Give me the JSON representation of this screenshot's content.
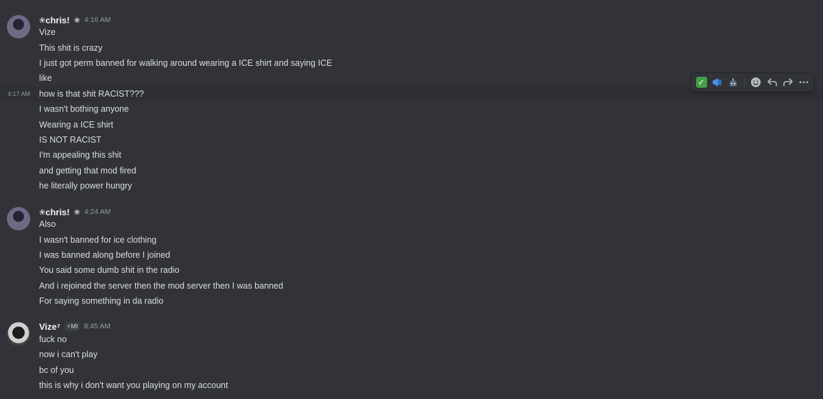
{
  "messages": [
    {
      "username": "chris!",
      "deco_left": "❀",
      "deco_right": "❀",
      "time": "4:16 AM",
      "lines": [
        "Vize",
        "This shit is crazy",
        "I just got perm banned for walking around wearing a ICE shirt and saying ICE",
        "like",
        "how is that shit RACIST???",
        "I wasn't bothing anyone",
        "Wearing a ICE shirt",
        "IS NOT RACIST",
        "I'm appealing this shit",
        "and getting that mod fired",
        "he literally power hungry"
      ],
      "hover_time": "4:17 AM"
    },
    {
      "username": "chris!",
      "deco_left": "❀",
      "deco_right": "❀",
      "time": "4:24 AM",
      "lines": [
        "Also",
        "I wasn't banned for ice clothing",
        "I was banned along before I joined",
        "You said some dumb shit in the radio",
        "And i rejoined the server then the mod server then I was banned",
        "For saying something in da radio"
      ]
    },
    {
      "username": "Vize⁷",
      "tag": "⚡MI",
      "time": "8:45 AM",
      "lines": [
        "fuck no",
        "now i can't play",
        "bc of you",
        "this is why i don't want you playing on my account"
      ]
    }
  ],
  "toolbar": {
    "icons": [
      "check-emoji",
      "megaphone-emoji",
      "robot-emoji",
      "add-reaction-icon",
      "reply-icon",
      "forward-icon",
      "more-icon"
    ]
  },
  "colors": {
    "background": "#313338",
    "text": "#dbdee1",
    "timestamp": "#949ba4",
    "username": "#f2f3f5"
  }
}
